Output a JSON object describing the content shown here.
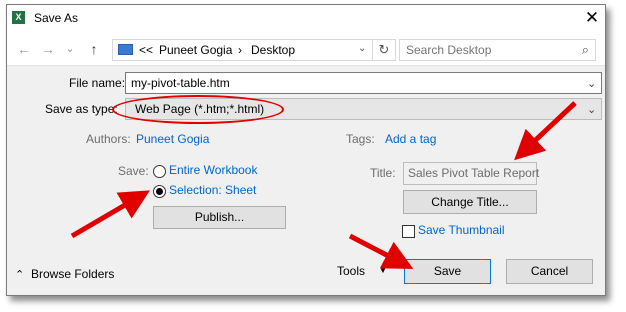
{
  "window": {
    "title": "Save As",
    "app_icon_text": "X",
    "close_glyph": "✕"
  },
  "nav": {
    "back": "←",
    "forward": "→",
    "history": "⌄",
    "up": "↑",
    "path_prefix": "<<",
    "path_segments": [
      "Puneet Gogia",
      "Desktop"
    ],
    "separator": "›",
    "refresh": "↻",
    "search_placeholder": "Search Desktop",
    "search_icon": "⌕"
  },
  "form": {
    "filename_label": "File name:",
    "filename_value": "my-pivot-table.htm",
    "savetype_label": "Save as type:",
    "savetype_value": "Web Page (*.htm;*.html)",
    "authors_label": "Authors:",
    "authors_value": "Puneet Gogia",
    "tags_label": "Tags:",
    "tags_value": "Add a tag",
    "save_label": "Save:",
    "radio_workbook": "Entire Workbook",
    "radio_selection": "Selection: Sheet",
    "publish_button": "Publish...",
    "title_label": "Title:",
    "title_value": "Sales Pivot Table Report",
    "change_title_button": "Change Title...",
    "save_thumbnail": "Save Thumbnail"
  },
  "footer": {
    "browse_folders": "Browse Folders",
    "browse_chevron": "⌃",
    "tools": "Tools",
    "tools_arrow": "▼",
    "save_button": "Save",
    "cancel_button": "Cancel"
  },
  "colors": {
    "annotation": "#e00000",
    "link": "#0066cc",
    "excel": "#217346"
  },
  "icons": [
    "excel-icon",
    "close-icon",
    "back-icon",
    "forward-icon",
    "up-icon",
    "folder-icon",
    "refresh-icon",
    "search-icon",
    "chevron-down-icon"
  ]
}
